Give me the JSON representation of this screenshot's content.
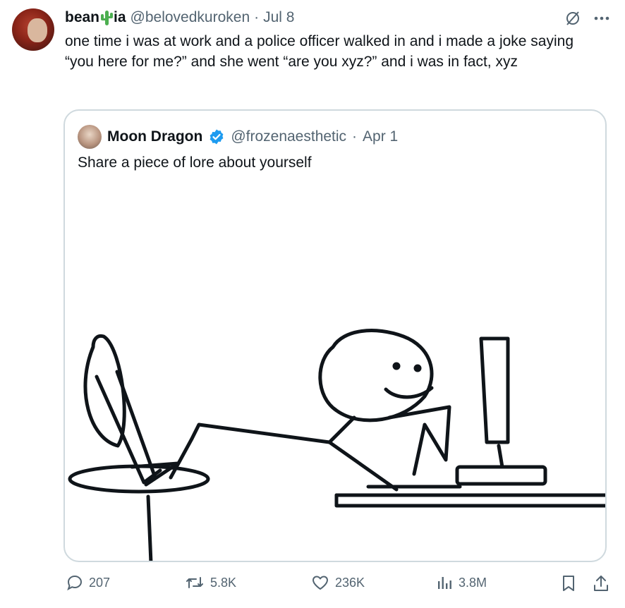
{
  "tweet": {
    "display_name_prefix": "bean",
    "display_name_suffix": "ia",
    "handle": "@belovedkuroken",
    "separator": "·",
    "date": "Jul 8",
    "text": "one time i was at work and a police officer walked in and i made a joke saying “you here for me?” and she went “are you xyz?” and i was in fact, xyz"
  },
  "quote": {
    "display_name": "Moon Dragon",
    "handle": "@frozenaesthetic",
    "separator": "·",
    "date": "Apr 1",
    "text": "Share a piece of lore about yourself"
  },
  "actions": {
    "replies": "207",
    "reposts": "5.8K",
    "likes": "236K",
    "views": "3.8M"
  },
  "colors": {
    "muted": "#536471",
    "border": "#cfd9de",
    "verified": "#1d9bf0",
    "cactus": "#4caf50"
  },
  "icons": [
    "grok-icon",
    "more-icon",
    "verified-icon",
    "cactus-emoji",
    "reply-icon",
    "repost-icon",
    "like-icon",
    "views-icon",
    "bookmark-icon",
    "share-icon"
  ]
}
